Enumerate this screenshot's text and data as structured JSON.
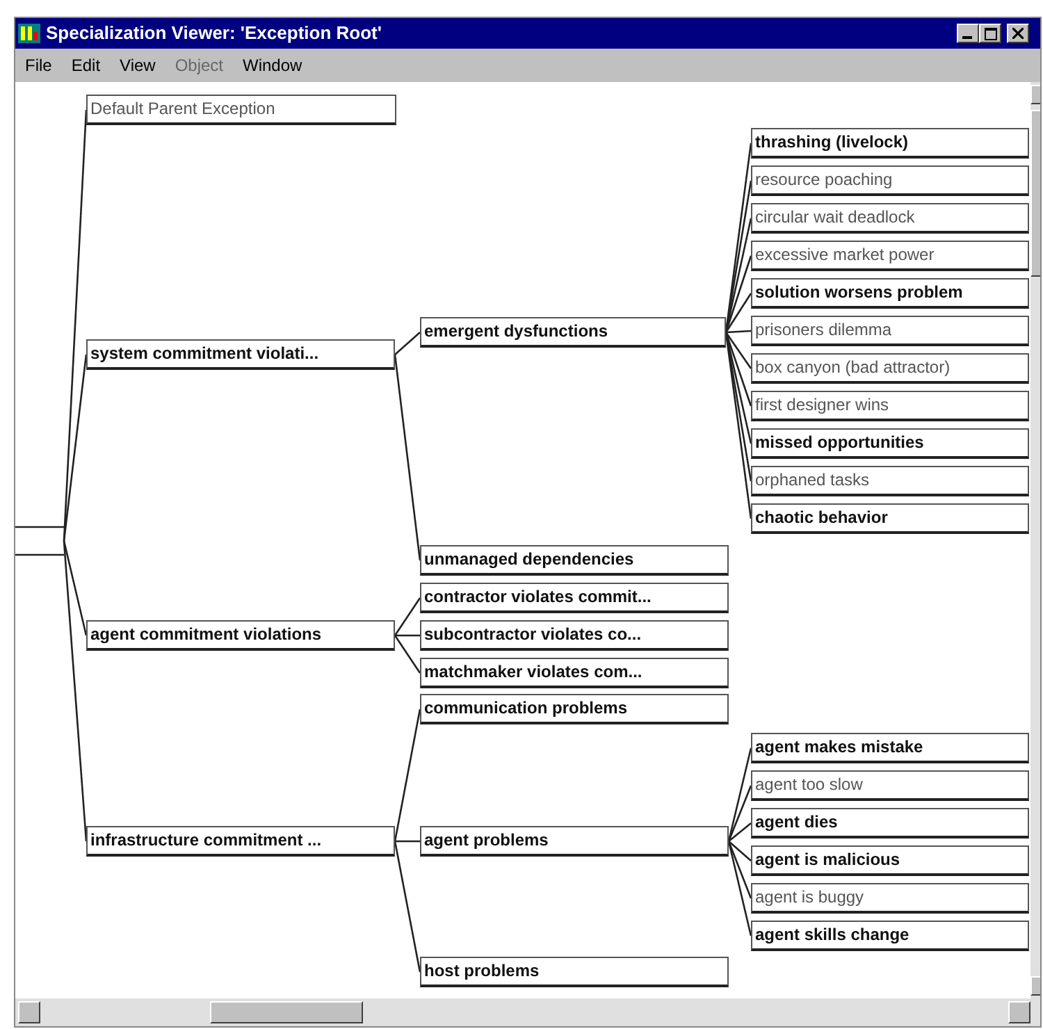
{
  "window": {
    "title": "Specialization Viewer: 'Exception Root'"
  },
  "menu": [
    {
      "label": "File",
      "disabled": false
    },
    {
      "label": "Edit",
      "disabled": false
    },
    {
      "label": "View",
      "disabled": false
    },
    {
      "label": "Object",
      "disabled": true
    },
    {
      "label": "Window",
      "disabled": false
    }
  ],
  "tree": [
    {
      "label": "Default Parent Exception",
      "emphasized": false
    },
    {
      "label": "system commitment violati...",
      "emphasized": true,
      "children": [
        {
          "label": "emergent dysfunctions",
          "emphasized": true,
          "children": [
            {
              "label": "thrashing (livelock)",
              "emphasized": true
            },
            {
              "label": "resource poaching",
              "emphasized": false
            },
            {
              "label": "circular wait deadlock",
              "emphasized": false
            },
            {
              "label": "excessive market power",
              "emphasized": false
            },
            {
              "label": "solution worsens problem",
              "emphasized": true
            },
            {
              "label": "prisoners dilemma",
              "emphasized": false
            },
            {
              "label": "box canyon (bad attractor)",
              "emphasized": false
            },
            {
              "label": "first designer wins",
              "emphasized": false
            },
            {
              "label": "missed opportunities",
              "emphasized": true
            },
            {
              "label": "orphaned tasks",
              "emphasized": false
            },
            {
              "label": "chaotic behavior",
              "emphasized": true
            }
          ]
        },
        {
          "label": "unmanaged dependencies",
          "emphasized": true
        }
      ]
    },
    {
      "label": "agent commitment violations",
      "emphasized": true,
      "children": [
        {
          "label": "contractor violates commit...",
          "emphasized": true
        },
        {
          "label": "subcontractor violates co...",
          "emphasized": true
        },
        {
          "label": "matchmaker violates com...",
          "emphasized": true
        }
      ]
    },
    {
      "label": "infrastructure commitment ...",
      "emphasized": true,
      "children": [
        {
          "label": "communication problems",
          "emphasized": true
        },
        {
          "label": "agent problems",
          "emphasized": true,
          "children": [
            {
              "label": "agent makes mistake",
              "emphasized": true
            },
            {
              "label": "agent too slow",
              "emphasized": false
            },
            {
              "label": "agent dies",
              "emphasized": true
            },
            {
              "label": "agent is malicious",
              "emphasized": true
            },
            {
              "label": "agent is buggy",
              "emphasized": false
            },
            {
              "label": "agent skills change",
              "emphasized": true
            }
          ]
        },
        {
          "label": "host problems",
          "emphasized": true
        }
      ]
    }
  ]
}
